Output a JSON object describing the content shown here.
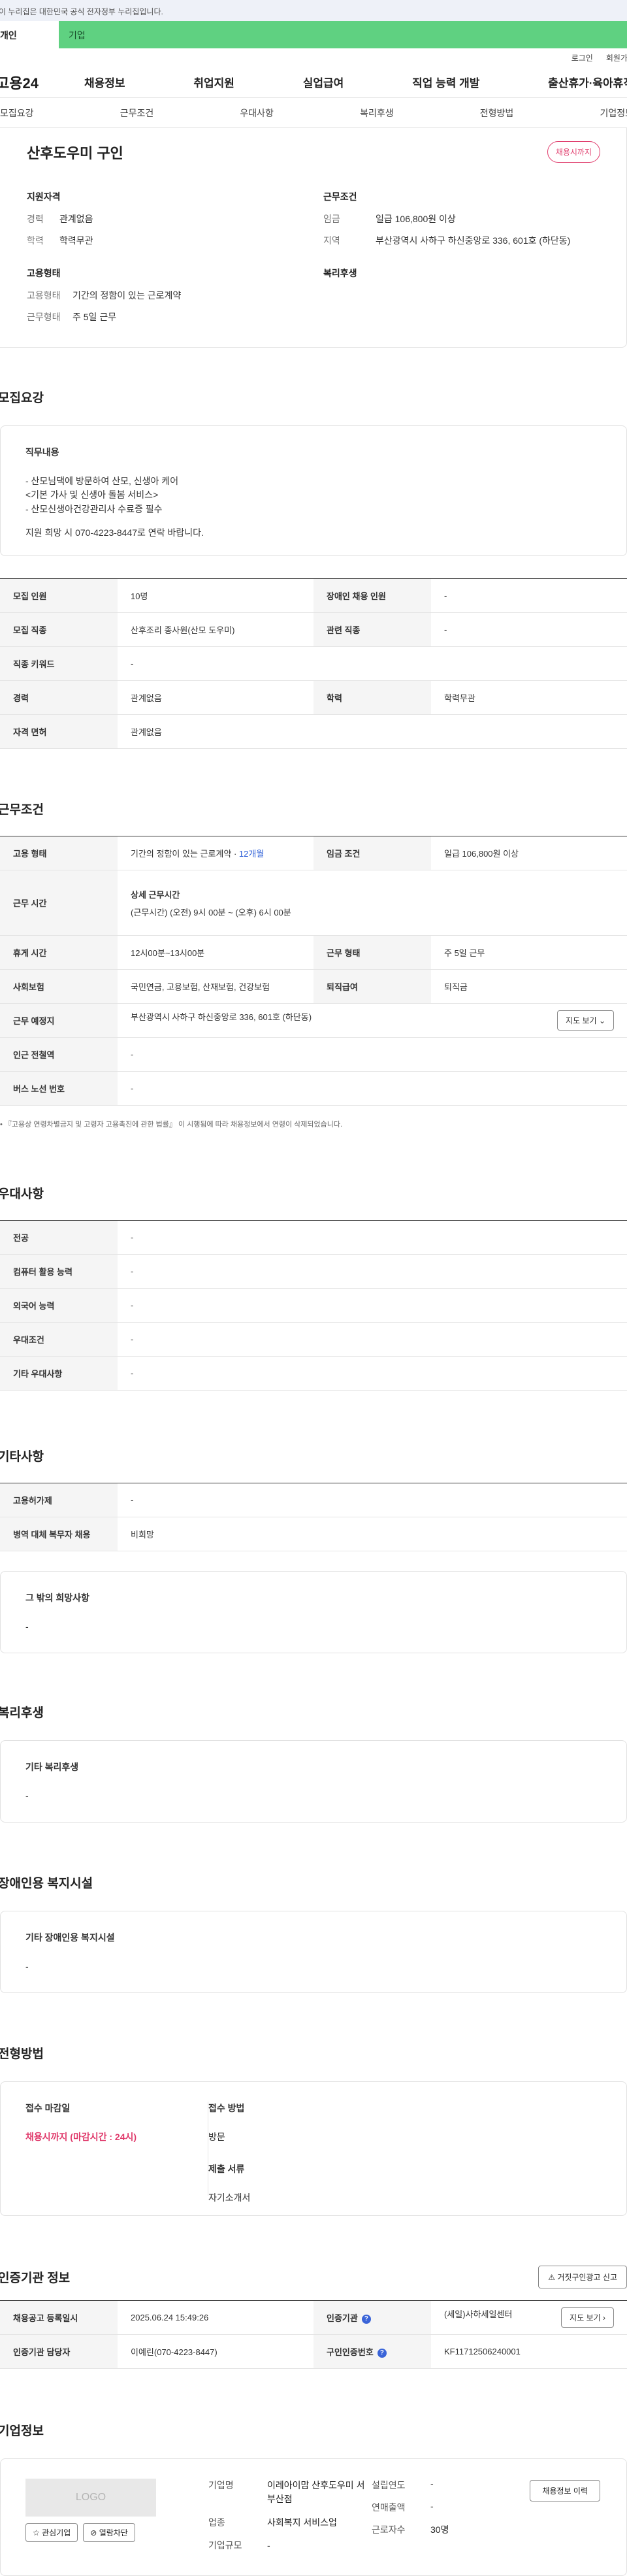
{
  "gov_banner": "이 누리집은 대한민국 공식 전자정부 누리집입니다.",
  "site_tabs": {
    "person": "개인",
    "corp": "기업"
  },
  "util": {
    "login": "로그인",
    "join": "회원가입"
  },
  "gnb": {
    "logo": "고용24",
    "menu": [
      "채용정보",
      "취업지원",
      "실업급여",
      "직업 능력 개발",
      "출산휴가·육아휴직"
    ]
  },
  "anchor_nav": [
    "모집요강",
    "근무조건",
    "우대사항",
    "복리후생",
    "전형방법",
    "기업정보"
  ],
  "summary": {
    "title": "산후도우미 구인",
    "badge": "채용시까지",
    "qual_title": "지원자격",
    "qual": [
      {
        "k": "경력",
        "v": "관계없음"
      },
      {
        "k": "학력",
        "v": "학력무관"
      }
    ],
    "emp_title": "고용형태",
    "emp": [
      {
        "k": "고용형태",
        "v": "기간의 정함이 있는 근로계약"
      },
      {
        "k": "근무형태",
        "v": "주 5일 근무"
      }
    ],
    "cond_title": "근무조건",
    "cond": [
      {
        "k": "임금",
        "v": "일급 106,800원 이상"
      },
      {
        "k": "지역",
        "v": "부산광역시 사하구 하신중앙로 336, 601호 (하단동)"
      }
    ],
    "welfare_title": "복리후생"
  },
  "recruit": {
    "title": "모집요강",
    "duty_title": "직무내용",
    "duty_lines": [
      "- 산모님댁에 방문하여 산모, 신생아 케어",
      "<기본 가사 및 신생아 돌봄 서비스>",
      "- 산모신생아건강관리사 수료증 필수"
    ],
    "duty_contact": "지원 희망 시 070-4223-8447로 연락 바랍니다.",
    "rows": {
      "headcount_k": "모집 인원",
      "headcount_v": "10명",
      "disabled_k": "장애인 채용 인원",
      "disabled_v": "-",
      "job_k": "모집 직종",
      "job_v": "산후조리 종사원(산모 도우미)",
      "related_k": "관련 직종",
      "related_v": "-",
      "keyword_k": "직종 키워드",
      "keyword_v": "-",
      "career_k": "경력",
      "career_v": "관계없음",
      "edu_k": "학력",
      "edu_v": "학력무관",
      "license_k": "자격 면허",
      "license_v": "관계없음"
    }
  },
  "work": {
    "title": "근무조건",
    "type_k": "고용 형태",
    "type_v": "기간의 정함이 있는 근로계약 · ",
    "type_months": "12개월",
    "wage_k": "임금 조건",
    "wage_v": "일급 106,800원 이상",
    "hours_k": "근무 시간",
    "hours_t": "상세 근무시간",
    "hours_v": "(근무시간) (오전) 9시 00분 ~ (오후) 6시 00분",
    "rest_k": "휴게 시간",
    "rest_v": "12시00분~13시00분",
    "form_k": "근무 형태",
    "form_v": "주 5일 근무",
    "ins_k": "사회보험",
    "ins_v": "국민연금, 고용보험, 산재보험, 건강보험",
    "sev_k": "퇴직급여",
    "sev_v": "퇴직금",
    "place_k": "근무 예정지",
    "place_v": "부산광역시 사하구 하신중앙로 336, 601호 (하단동)",
    "map_btn": "지도 보기",
    "station_k": "인근 전철역",
    "station_v": "-",
    "bus_k": "버스 노선 번호",
    "bus_v": "-",
    "note": "『고용상 연령차별금지 및 고령자 고용촉진에 관한 법률』 이 시행됨에 따라 채용정보에서 연령이 삭제되었습니다."
  },
  "pref": {
    "title": "우대사항",
    "rows": [
      {
        "k": "전공",
        "v": "-"
      },
      {
        "k": "컴퓨터 활용 능력",
        "v": "-"
      },
      {
        "k": "외국어 능력",
        "v": "-"
      },
      {
        "k": "우대조건",
        "v": "-"
      },
      {
        "k": "기타 우대사항",
        "v": "-"
      }
    ]
  },
  "etc": {
    "title": "기타사항",
    "rows": [
      {
        "k": "고용허가제",
        "v": "-"
      },
      {
        "k": "병역 대체 복무자 채용",
        "v": "비희망"
      }
    ],
    "other_title": "그 밖의 희망사항",
    "other_v": "-"
  },
  "welfare": {
    "title": "복리후생",
    "sub": "기타 복리후생",
    "v": "-"
  },
  "disabled": {
    "title": "장애인용 복지시설",
    "sub": "기타 장애인용 복지시설",
    "v": "-"
  },
  "screening": {
    "title": "전형방법",
    "deadline_k": "접수 마감일",
    "deadline_v": "채용시까지 (마감시간 : 24시)",
    "method_k": "접수 방법",
    "method_v": "방문",
    "docs_k": "제출 서류",
    "docs_v": "자기소개서"
  },
  "cert": {
    "title": "인증기관 정보",
    "report_btn": "거짓구인광고 신고",
    "reg_k": "채용공고 등록일시",
    "reg_v": "2025.06.24 15:49:26",
    "org_k": "인증기관",
    "org_v": "(세일)사하세일센터",
    "map_btn": "지도 보기",
    "staff_k": "인증기관 담당자",
    "staff_v": "이예린(070-4223-8447)",
    "num_k": "구인인증번호",
    "num_v": "KF11712506240001"
  },
  "company": {
    "title": "기업정보",
    "logo_text": "LOGO",
    "fav_btn": "관심기업",
    "block_btn": "열람차단",
    "history_btn": "채용정보 이력",
    "name_k": "기업명",
    "name_v": "이레아이맘 산후도우미 서부산점",
    "year_k": "설립연도",
    "year_v": "-",
    "sales_k": "연매출액",
    "sales_v": "-",
    "industry_k": "업종",
    "industry_v": "사회복지 서비스업",
    "staff_k": "근로자수",
    "staff_v": "30명",
    "size_k": "기업규모",
    "size_v": "-"
  }
}
